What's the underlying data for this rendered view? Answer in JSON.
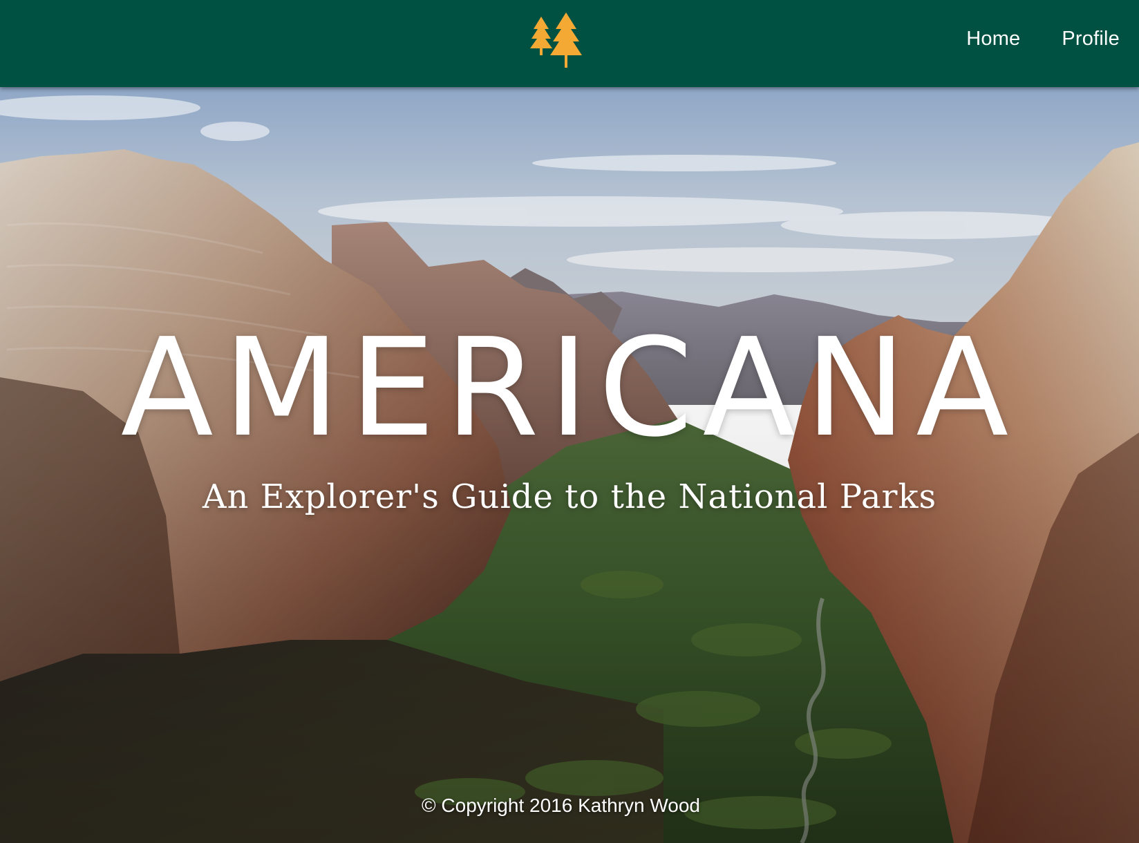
{
  "nav": {
    "logo_icon": "pine-trees-icon",
    "links": [
      {
        "label": "Home"
      },
      {
        "label": "Profile"
      }
    ]
  },
  "hero": {
    "title": "AMERICANA",
    "subtitle": "An Explorer's Guide to the National Parks",
    "background": "canyon-landscape-photo"
  },
  "footer": {
    "copyright": "© Copyright 2016 Kathryn Wood"
  },
  "colors": {
    "navbar": "#005141",
    "logo": "#F4A935",
    "text": "#ffffff"
  }
}
